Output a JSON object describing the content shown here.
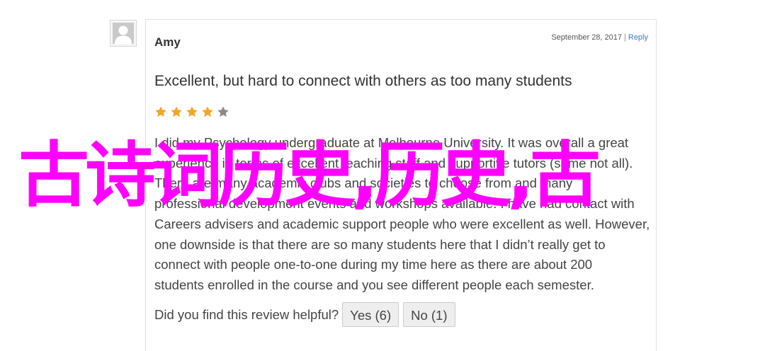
{
  "review": {
    "author": "Amy",
    "date": "September 28, 2017",
    "separator": "|",
    "reply_label": "Reply",
    "title": "Excellent, but hard to connect with others as too many students",
    "rating": 4,
    "rating_max": 5,
    "body_lines": [
      "I did my Psychology undergraduate at Melbourne University. It was overall a great",
      "experience in terms of excellent teaching staff and supportive tutors (some not all).",
      "There are many academic clubs and societies to choose from and many",
      "professional development events and workshops available. I have had contact with",
      "Careers advisers and academic support people who were excellent as well. However,",
      "one downside is that there are so many students here that I didn’t really get to",
      "connect with people one-to-one during my time here as there are about 200",
      "students enrolled in the course and you see different people each semester."
    ],
    "helpful_question": "Did you find this review helpful?",
    "yes_label": "Yes (6)",
    "no_label": "No (1)"
  },
  "overlay_text": "古诗词历史,历史,古",
  "colors": {
    "star_filled": "#f5a623",
    "star_empty": "#8a8a8a",
    "link": "#3b7bbf",
    "overlay": "#ff00ff"
  }
}
